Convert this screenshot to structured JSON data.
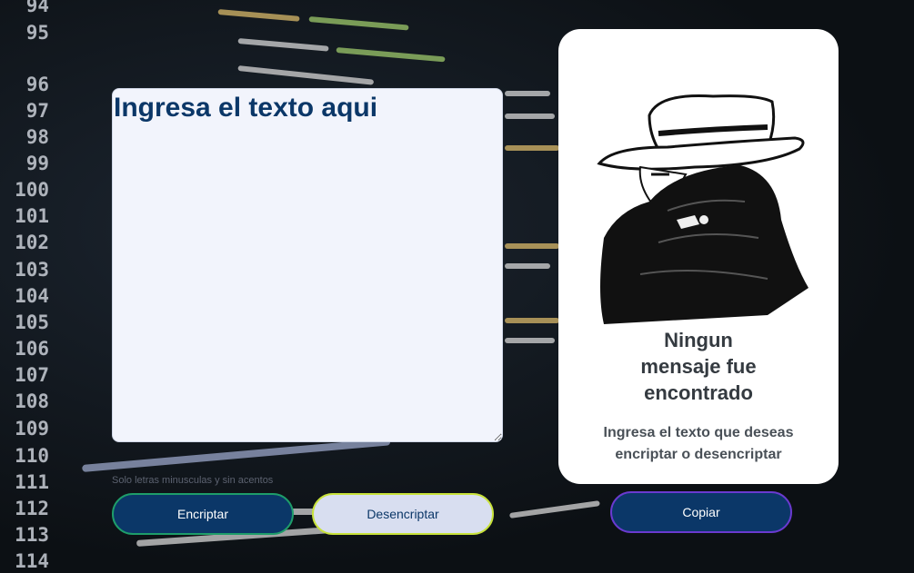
{
  "background": {
    "line_numbers": [
      "94",
      "95",
      "96",
      "97",
      "98",
      "99",
      "100",
      "101",
      "102",
      "103",
      "104",
      "105",
      "106",
      "107",
      "108",
      "109",
      "110",
      "111",
      "112",
      "113",
      "114"
    ]
  },
  "input": {
    "placeholder": "Ingresa el texto aqui",
    "hint": "Solo letras minusculas y sin acentos"
  },
  "buttons": {
    "encrypt": "Encriptar",
    "decrypt": "Desencriptar",
    "copy": "Copiar"
  },
  "output": {
    "title_lines": [
      "Ningun",
      "mensaje fue",
      "encontrado"
    ],
    "subtitle_lines": [
      "Ingresa el texto que deseas",
      "encriptar o desencriptar"
    ]
  },
  "colors": {
    "primary": "#0b3768",
    "card": "#f2f4fc",
    "encrypt_border": "#1e9d6a",
    "decrypt_border": "#c8e23a",
    "copy_border": "#6a3ad0"
  }
}
